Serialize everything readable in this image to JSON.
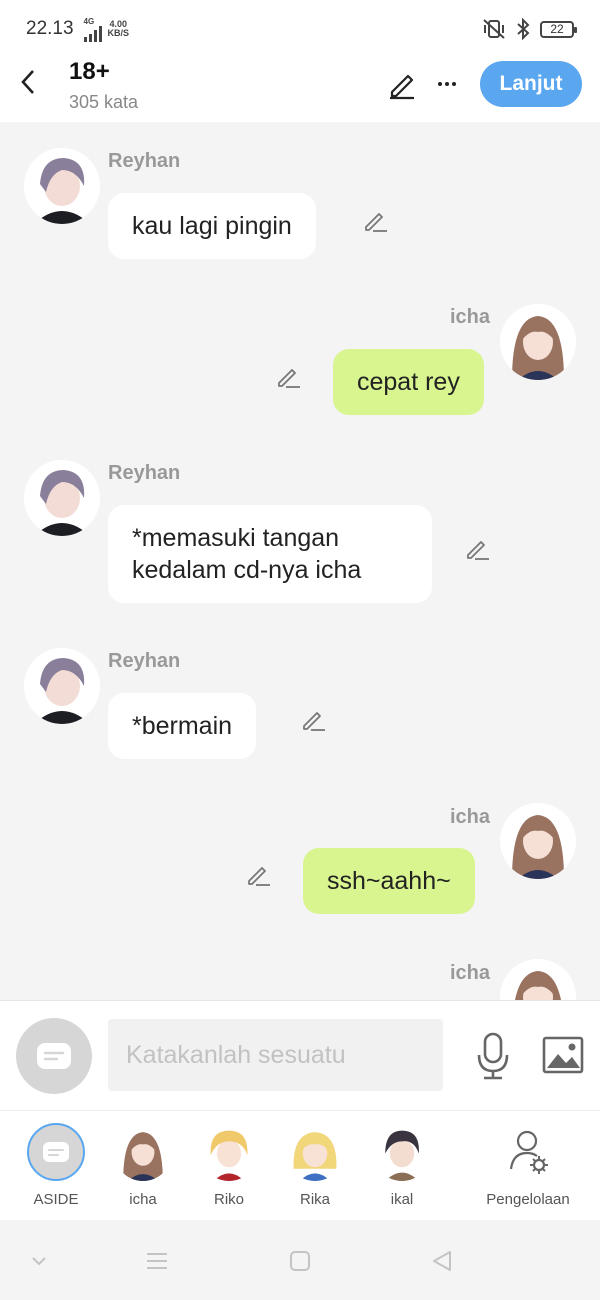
{
  "status": {
    "time": "22.13",
    "network": "4G",
    "speed_value": "4.00",
    "speed_unit": "KB/S",
    "battery": "22"
  },
  "header": {
    "title": "18+",
    "word_count": "305 kata",
    "next_label": "Lanjut"
  },
  "messages": [
    {
      "speaker": "Reyhan",
      "text": "kau lagi pingin",
      "side": "left"
    },
    {
      "speaker": "icha",
      "text": "cepat rey",
      "side": "right"
    },
    {
      "speaker": "Reyhan",
      "text_lines": [
        "*memasuki tangan",
        "kedalam cd-nya icha"
      ],
      "side": "left"
    },
    {
      "speaker": "Reyhan",
      "text": "*bermain",
      "side": "left"
    },
    {
      "speaker": "icha",
      "text": "ssh~aahh~",
      "side": "right"
    },
    {
      "speaker": "icha",
      "text": "",
      "side": "right"
    }
  ],
  "input": {
    "placeholder": "Katakanlah sesuatu"
  },
  "characters": [
    {
      "label": "ASIDE"
    },
    {
      "label": "icha"
    },
    {
      "label": "Riko"
    },
    {
      "label": "Rika"
    },
    {
      "label": "ikal"
    },
    {
      "label": "Pengelolaan"
    }
  ],
  "colors": {
    "accent": "#5aa7f0",
    "bubble_right": "#d8f58f",
    "bubble_left": "#ffffff",
    "background": "#f4f4f4"
  }
}
